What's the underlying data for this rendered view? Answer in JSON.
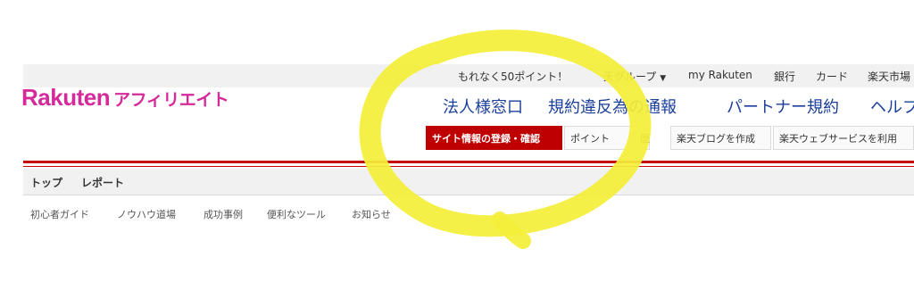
{
  "utility_nav": {
    "points_promo": "もれなく50ポイント！",
    "group_menu": "天グループ",
    "my_rakuten": "my Rakuten",
    "bank": "銀行",
    "card": "カード",
    "ichiba": "楽天市場"
  },
  "logo": {
    "brand": "Rakuten",
    "suffix": "アフィリエイト"
  },
  "main_links": {
    "corporate": "法人様窓口",
    "violation_a": "規約違反",
    "violation_b": "為の通報",
    "partner_terms": "パートナー規約",
    "help": "ヘルプ"
  },
  "sub_buttons": {
    "site_register": "サイト情報の登録・確認",
    "point_history_a": "ポイント",
    "point_history_b": "歴",
    "create_blog": "楽天ブログを作成",
    "web_service": "楽天ウェブサービスを利用"
  },
  "global_nav": {
    "top": "トップ",
    "report": "レポート"
  },
  "sub_nav": {
    "beginner_guide": "初心者ガイド",
    "knowhow": "ノウハウ道場",
    "success_cases": "成功事例",
    "tools": "便利なツール",
    "news": "お知らせ"
  },
  "colors": {
    "brand_pink": "#d52a9a",
    "link_blue": "#1a3e9a",
    "rakuten_red": "#bf0000",
    "highlight_yellow": "#f3ef3a"
  }
}
